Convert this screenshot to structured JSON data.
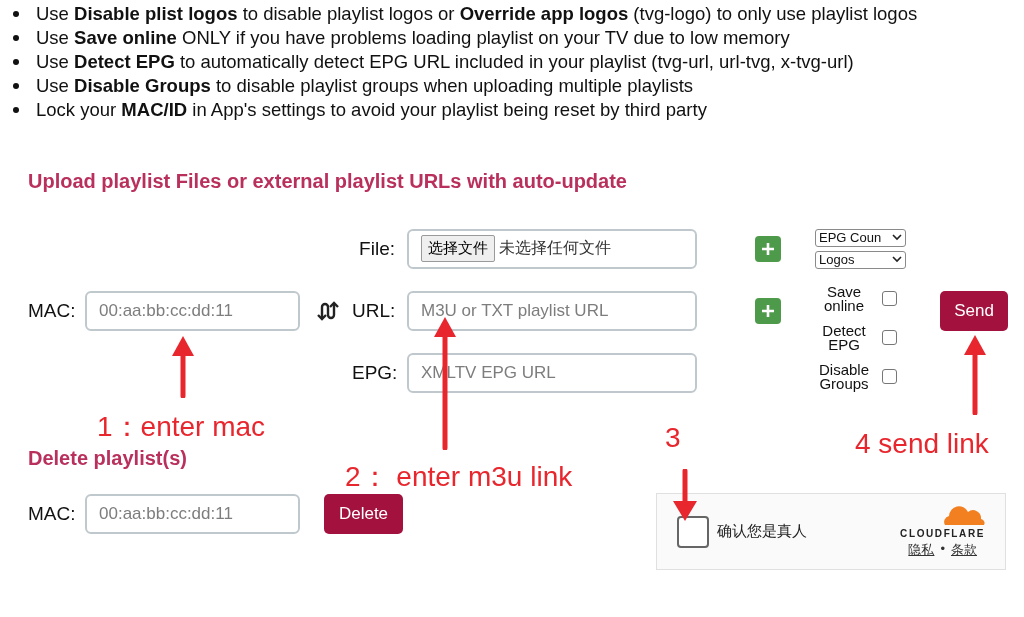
{
  "instructions": [
    "Use **Disable plist logos** to disable playlist logos or **Override app logos** (tvg-logo) to only use playlist logos",
    "Use **Save online** ONLY if you have problems loading playlist on your TV due to low memory",
    "Use **Detect EPG** to automatically detect EPG URL included in your playlist (tvg-url, url-tvg, x-tvg-url)",
    "Use **Disable Groups** to disable playlist groups when uploading multiple playlists",
    "Lock your **MAC/ID** in App's settings to avoid your playlist being reset by third party"
  ],
  "upload": {
    "heading": "Upload playlist Files or external playlist URLs with auto-update",
    "mac": {
      "label": "MAC:",
      "placeholder": "00:aa:bb:cc:dd:11"
    },
    "file": {
      "label": "File:",
      "button": "选择文件",
      "status": "未选择任何文件"
    },
    "url": {
      "label": "URL:",
      "placeholder": "M3U or TXT playlist URL"
    },
    "epg": {
      "label": "EPG:",
      "placeholder": "XMLTV EPG URL"
    },
    "selects": [
      {
        "value": "EPG Coun"
      },
      {
        "value": "Logos"
      }
    ],
    "options": [
      {
        "label": "Save online",
        "checked": false
      },
      {
        "label": "Detect EPG",
        "checked": false
      },
      {
        "label": "Disable Groups",
        "checked": false
      }
    ],
    "send": "Send"
  },
  "delete": {
    "heading": "Delete playlist(s)",
    "mac": {
      "label": "MAC:",
      "placeholder": "00:aa:bb:cc:dd:11"
    },
    "button": "Delete"
  },
  "captcha": {
    "checked": false,
    "label": "确认您是真人",
    "brand": "CLOUDFLARE",
    "links": [
      "隐私",
      "条款"
    ],
    "separator": "•"
  },
  "annotations": [
    {
      "text": "1：enter mac"
    },
    {
      "text": "2：  enter m3u link"
    },
    {
      "text": "3"
    },
    {
      "text": "4 send link"
    }
  ]
}
